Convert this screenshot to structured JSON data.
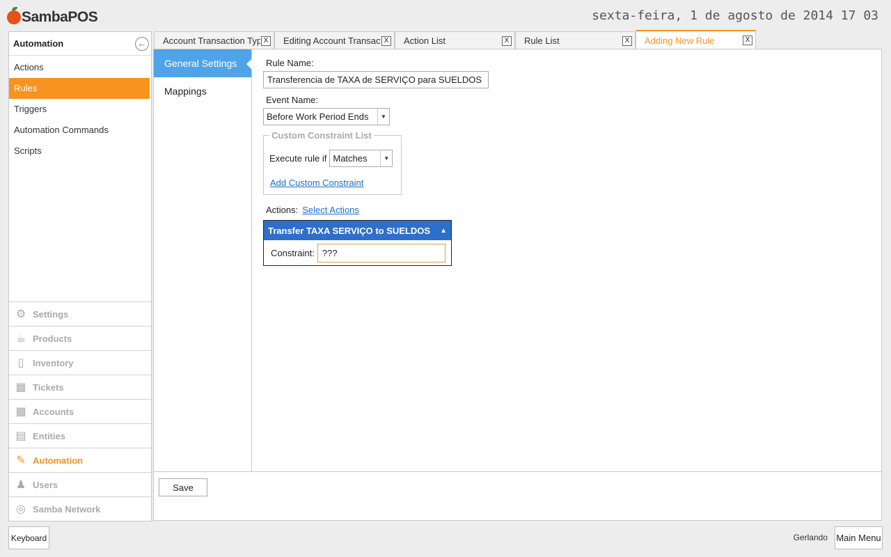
{
  "header": {
    "logo_text": "SambaPOS",
    "clock": "sexta-feira, 1 de agosto de 2014 17 03"
  },
  "left_panel": {
    "title": "Automation",
    "items": [
      {
        "label": "Actions",
        "active": false
      },
      {
        "label": "Rules",
        "active": true
      },
      {
        "label": "Triggers",
        "active": false
      },
      {
        "label": "Automation Commands",
        "active": false
      },
      {
        "label": "Scripts",
        "active": false
      }
    ],
    "nav": [
      {
        "label": "Settings",
        "icon": "gear-icon"
      },
      {
        "label": "Products",
        "icon": "cup-icon"
      },
      {
        "label": "Inventory",
        "icon": "box-icon"
      },
      {
        "label": "Tickets",
        "icon": "books-icon"
      },
      {
        "label": "Accounts",
        "icon": "calculator-icon"
      },
      {
        "label": "Entities",
        "icon": "calendar-icon"
      },
      {
        "label": "Automation",
        "icon": "pen-icon",
        "active": true
      },
      {
        "label": "Users",
        "icon": "user-icon"
      },
      {
        "label": "Samba Network",
        "icon": "globe-icon"
      }
    ]
  },
  "tabs": [
    {
      "label": "Account Transaction Types",
      "close": "X",
      "active": false
    },
    {
      "label": "Editing Account Transaction Type",
      "close": "X",
      "active": false
    },
    {
      "label": "Action List",
      "close": "X",
      "active": false
    },
    {
      "label": "Rule List",
      "close": "X",
      "active": false
    },
    {
      "label": "Adding New Rule",
      "close": "X",
      "active": true
    }
  ],
  "subnav": [
    {
      "label": "General Settings",
      "active": true
    },
    {
      "label": "Mappings",
      "active": false
    }
  ],
  "form": {
    "rule_name_label": "Rule Name:",
    "rule_name_value": "Transferencia de TAXA de SERVIÇO para SUELDOS",
    "event_name_label": "Event Name:",
    "event_name_value": "Before Work Period Ends",
    "constraint_group_title": "Custom Constraint List",
    "execute_rule_label": "Execute rule if",
    "execute_rule_value": "Matches",
    "add_constraint_link": "Add Custom Constraint",
    "actions_label": "Actions:",
    "select_actions_link": "Select Actions",
    "action_title": "Transfer TAXA SERVIÇO to SUELDOS",
    "constraint_label": "Constraint:",
    "constraint_value": "???",
    "save_label": "Save"
  },
  "footer": {
    "keyboard_label": "Keyboard",
    "user_name": "Gerlando",
    "main_menu_label": "Main Menu"
  },
  "colors": {
    "accent_orange": "#f7931e",
    "subnav_blue": "#4fa3e8",
    "action_header_blue": "#2d6fca",
    "link_blue": "#1a6fc8"
  }
}
